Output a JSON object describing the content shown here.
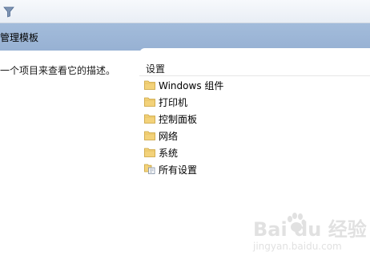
{
  "header": {
    "title": "管理模板"
  },
  "left_pane": {
    "description": "一个项目来查看它的描述。"
  },
  "list": {
    "column_header": "设置",
    "items": [
      {
        "label": "Windows 组件",
        "icon": "folder-icon"
      },
      {
        "label": "打印机",
        "icon": "folder-icon"
      },
      {
        "label": "控制面板",
        "icon": "folder-icon"
      },
      {
        "label": "网络",
        "icon": "folder-icon"
      },
      {
        "label": "系统",
        "icon": "folder-icon"
      },
      {
        "label": "所有设置",
        "icon": "settings-page-icon"
      }
    ]
  },
  "watermark": {
    "brand": "Bai du 经验",
    "url": "jingyan.baidu.com"
  },
  "colors": {
    "header_bg": "#9db6d7",
    "toolbar_bg": "#eef2f7",
    "folder": "#f3d27a"
  }
}
